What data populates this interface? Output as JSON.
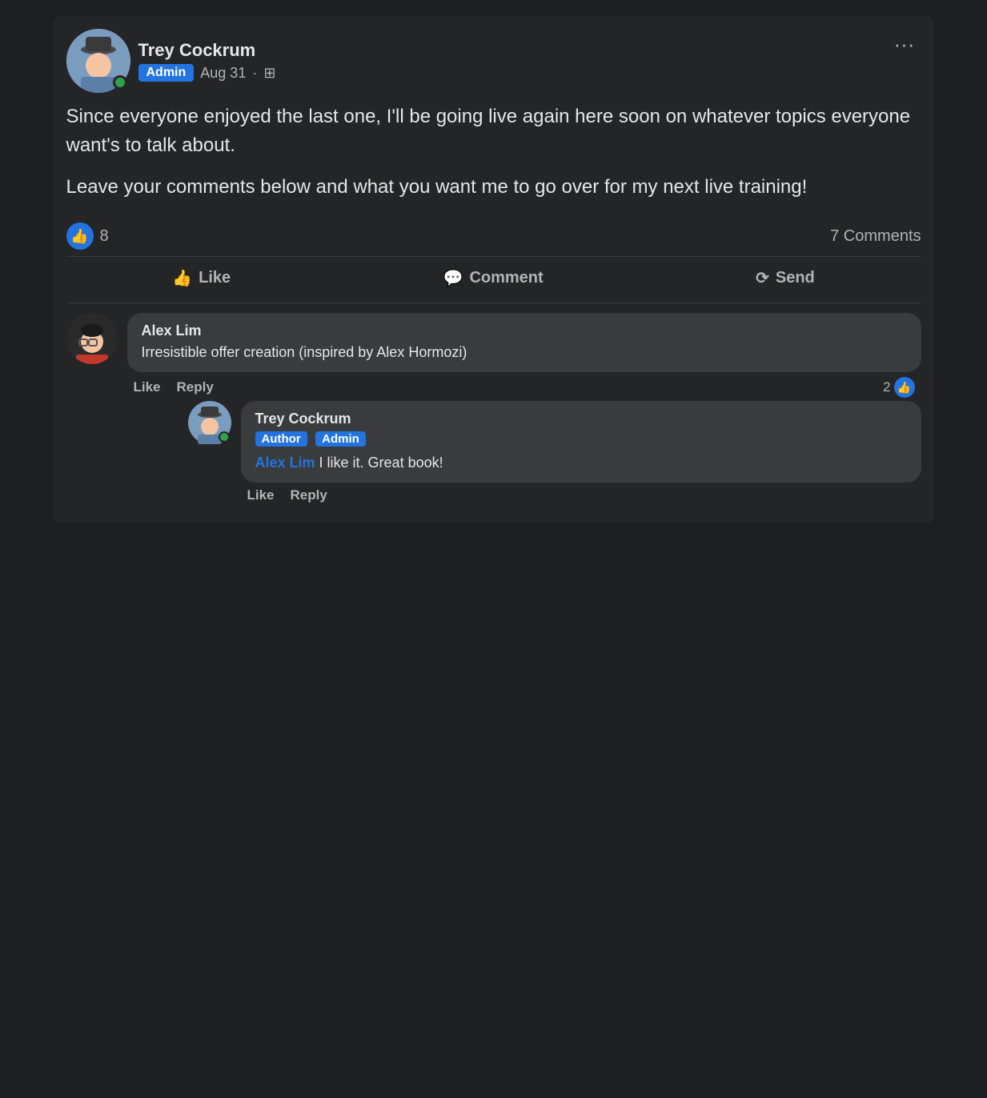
{
  "post": {
    "author": {
      "name": "Trey Cockrum",
      "badge": "Admin",
      "date": "Aug 31",
      "online": true
    },
    "content_p1": "Since everyone enjoyed the last one, I'll be going live again here soon on whatever topics everyone want's to talk about.",
    "content_p2": "Leave your comments below and what you want me to go over for my next live training!",
    "likes_count": "8",
    "comments_count": "7 Comments",
    "actions": {
      "like": "Like",
      "comment": "Comment",
      "send": "Send"
    }
  },
  "comments": [
    {
      "author": "Alex Lim",
      "text": "Irresistible offer creation (inspired by Alex Hormozi)",
      "like_label": "Like",
      "reply_label": "Reply",
      "likes": "2",
      "replies": [
        {
          "author": "Trey Cockrum",
          "badge_author": "Author",
          "badge_admin": "Admin",
          "mention": "Alex Lim",
          "text": " I like it. Great book!",
          "like_label": "Like",
          "reply_label": "Reply"
        }
      ]
    }
  ]
}
